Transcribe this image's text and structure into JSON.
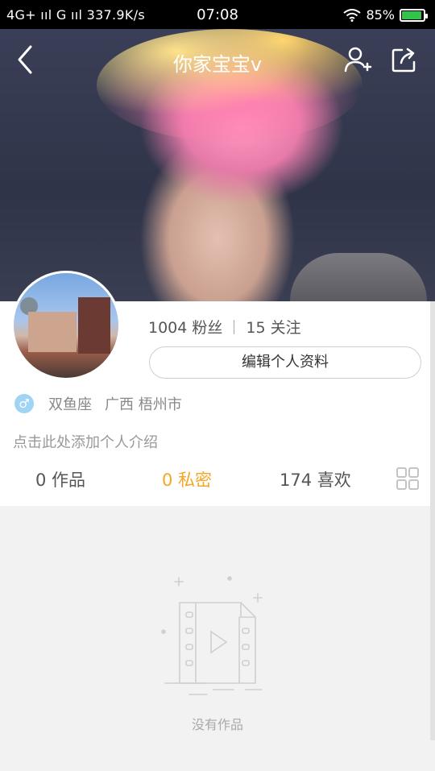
{
  "status_bar": {
    "network": "4G+ ııl G ııl 337.9K/s",
    "time": "07:08",
    "battery": "85%"
  },
  "header": {
    "title": "你家宝宝v"
  },
  "profile": {
    "followers": "1004 粉丝",
    "following": "15 关注",
    "edit_button": "编辑个人资料",
    "gender_symbol": "♂",
    "constellation": "双鱼座",
    "location": "广西 梧州市",
    "intro_placeholder": "点击此处添加个人介绍"
  },
  "tabs": [
    {
      "label": "0 作品",
      "active": false
    },
    {
      "label": "0 私密",
      "active": true
    },
    {
      "label": "174 喜欢",
      "active": false
    }
  ],
  "empty_state": {
    "message": "没有作品"
  },
  "colors": {
    "accent": "#f5a623",
    "gender_badge": "#9fd4f5"
  },
  "icons": [
    "back-icon",
    "add-user-icon",
    "share-icon",
    "grid-view-icon",
    "empty-video-icon"
  ]
}
